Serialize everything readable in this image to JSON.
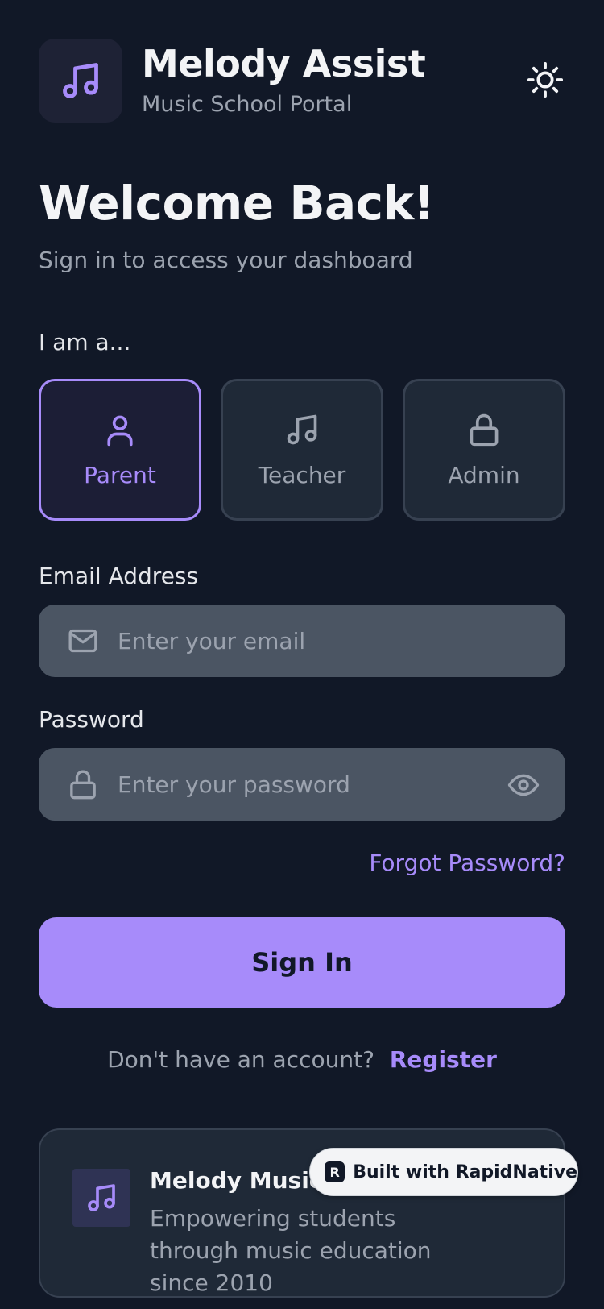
{
  "app": {
    "title": "Melody Assist",
    "subtitle": "Music School Portal",
    "logo_icon": "music-note-icon",
    "theme_toggle_icon": "sun-icon"
  },
  "welcome": {
    "title": "Welcome Back!",
    "subtitle": "Sign in to access your dashboard"
  },
  "role_selector": {
    "label": "I am a...",
    "selected": "Parent",
    "options": [
      {
        "label": "Parent",
        "icon": "user-icon"
      },
      {
        "label": "Teacher",
        "icon": "music-note-icon"
      },
      {
        "label": "Admin",
        "icon": "lock-icon"
      }
    ]
  },
  "form": {
    "email_label": "Email Address",
    "email_placeholder": "Enter your email",
    "email_value": "",
    "password_label": "Password",
    "password_placeholder": "Enter your password",
    "password_value": "",
    "forgot_label": "Forgot Password?",
    "signin_label": "Sign In"
  },
  "register": {
    "prompt": "Don't have an account?",
    "link": "Register"
  },
  "info_card": {
    "title": "Melody Music School",
    "description": "Empowering students through music education since 2010"
  },
  "badge": {
    "logo_letter": "R",
    "text": "Built with RapidNative"
  },
  "colors": {
    "background": "#111827",
    "accent": "#a78bfa",
    "card": "#1f2937",
    "input": "#4b5563"
  }
}
